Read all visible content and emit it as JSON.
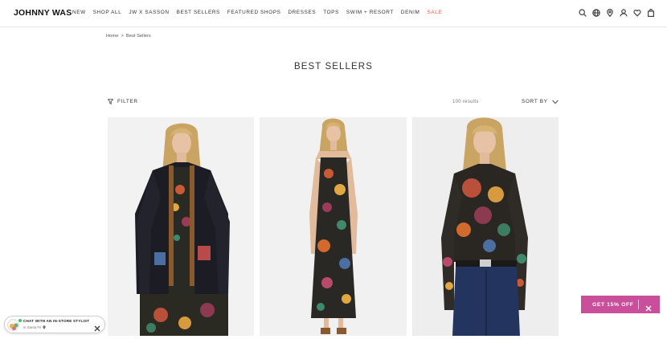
{
  "header": {
    "logo": "JOHNNY WAS",
    "nav": [
      {
        "label": "NEW"
      },
      {
        "label": "SHOP ALL"
      },
      {
        "label": "JW X SASSON"
      },
      {
        "label": "BEST SELLERS"
      },
      {
        "label": "FEATURED SHOPS"
      },
      {
        "label": "DRESSES"
      },
      {
        "label": "TOPS"
      },
      {
        "label": "SWIM + RESORT"
      },
      {
        "label": "DENIM"
      },
      {
        "label": "SALE"
      }
    ],
    "icons": [
      "search-icon",
      "globe-icon",
      "location-icon",
      "account-icon",
      "wishlist-icon",
      "bag-icon"
    ]
  },
  "breadcrumb": {
    "home": "Home",
    "separator": ">",
    "current": "Best Sellers"
  },
  "page": {
    "title": "BEST SELLERS"
  },
  "toolbar": {
    "filter_label": "FILTER",
    "results": "100 results",
    "sort_label": "SORT BY"
  },
  "products": [
    {
      "image": "model-in-black-embroidered-jacket"
    },
    {
      "image": "model-in-floral-maxi-dress"
    },
    {
      "image": "model-in-floral-mesh-top-and-jeans"
    }
  ],
  "chat": {
    "title": "CHAT WITH AN IN-STORE STYLIST",
    "location": "in Santa Fe"
  },
  "promo": {
    "label": "GET 15% OFF"
  },
  "colors": {
    "sale": "#e2574c",
    "promo": "#c94f9b",
    "online": "#3cc35f"
  }
}
